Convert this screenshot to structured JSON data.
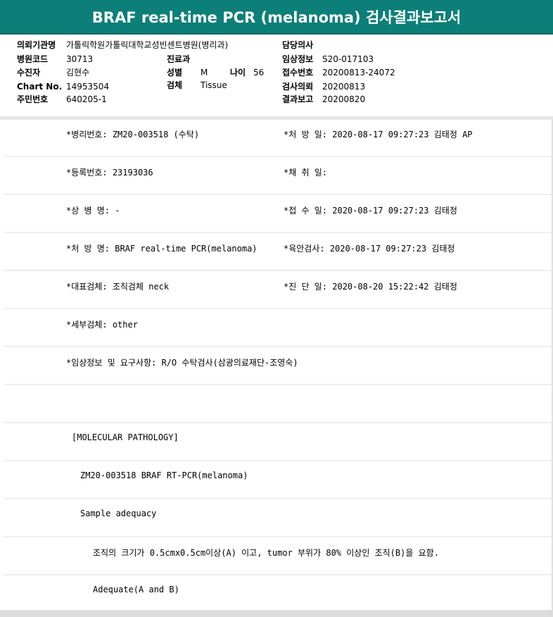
{
  "title": "BRAF real-time PCR (melanoma) 검사결과보고서",
  "header": {
    "institution_label": "의뢰기관명",
    "institution_value": "가톨릭학원가톨릭대학교성빈센트병원(병리과)",
    "hospital_code_label": "병원코드",
    "hospital_code_value": "30713",
    "department_label": "진료과",
    "department_value": "",
    "examinee_label": "수진자",
    "examinee_value": "김현수",
    "sex_label": "성별",
    "sex_value": "M",
    "age_label": "나이",
    "age_value": "56",
    "chart_label": "Chart No.",
    "chart_value": "14953504",
    "specimen_label": "검체",
    "specimen_value": "Tissue",
    "resident_label": "주민번호",
    "resident_value": "640205-1",
    "physician_label": "담당의사",
    "physician_value": "",
    "clinical_label": "임상정보",
    "clinical_value": "S20-017103",
    "receipt_label": "접수번호",
    "receipt_value": "20200813-24072",
    "request_label": "검사의뢰",
    "request_value": "20200813",
    "report_label": "결과보고",
    "report_value": "20200820"
  },
  "rows": [
    {
      "left": "*병리번호: ZM20-003518 (수탁)",
      "right": "*처 방 일: 2020-08-17 09:27:23  김태정 AP"
    },
    {
      "left": "*등록번호: 23193036",
      "right": "*채 취 일:"
    },
    {
      "left": "*상 병 명: -",
      "right": "*접 수 일: 2020-08-17 09:27:23  김태정"
    },
    {
      "left": "*처 방 명: BRAF real-time PCR(melanoma)",
      "right": "*육안검사: 2020-08-17 09:27:23  김태정"
    },
    {
      "left": "*대표검체: 조직검체 neck",
      "right": "*진 단 일: 2020-08-20 15:22:42  김태정"
    },
    {
      "left": "*세부검체: other",
      "right": ""
    },
    {
      "left": "*임상정보 및 요구사항: R/O 수탁검사(삼광의료재단-조영숙)",
      "right": ""
    },
    {
      "left": "",
      "right": ""
    },
    {
      "left": "[MOLECULAR PATHOLOGY]",
      "right": ""
    },
    {
      "left": "ZM20-003518     BRAF RT-PCR(melanoma)",
      "right": ""
    },
    {
      "left": "Sample adequacy",
      "right": ""
    },
    {
      "left": "조직의 크기가 0.5cmx0.5cm이상(A) 이고, tumor 부위가 80% 이상인 조직(B)을 요함.",
      "right": ""
    },
    {
      "left": "Adequate(A and B)",
      "right": ""
    }
  ]
}
